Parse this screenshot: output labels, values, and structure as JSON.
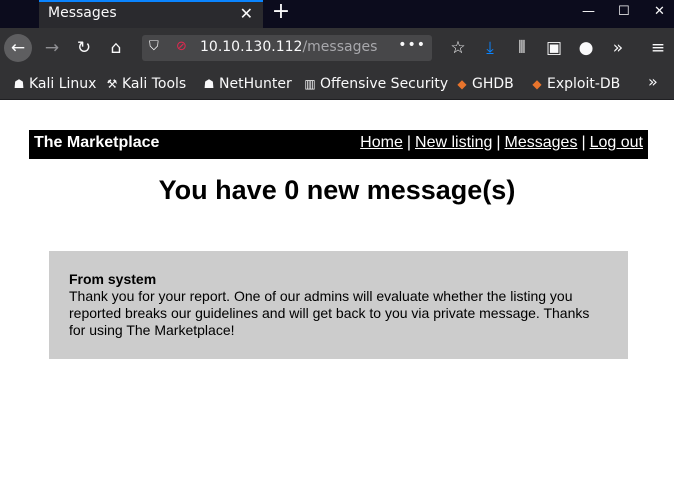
{
  "browser": {
    "tab_title": "Messages",
    "url_host": "10.10.130.112",
    "url_path": "/messages",
    "bookmarks": [
      "Kali Linux",
      "Kali Tools",
      "NetHunter",
      "Offensive Security",
      "GHDB",
      "Exploit-DB"
    ]
  },
  "site": {
    "brand": "The Marketplace",
    "nav": [
      "Home",
      "New listing",
      "Messages",
      "Log out"
    ],
    "separator": "|"
  },
  "main": {
    "heading": "You have 0 new message(s)",
    "messages": [
      {
        "from": "From system",
        "body": "Thank you for your report. One of our admins will evaluate whether the listing you reported breaks our guidelines and will get back to you via private message. Thanks for using The Marketplace!"
      }
    ]
  },
  "colors": {
    "accent": "#0a84ff",
    "header_bg": "#000000",
    "message_bg": "#cccccc",
    "chrome_bg": "#323234"
  },
  "icons": {
    "back": "arrow-left-icon",
    "forward": "arrow-right-icon",
    "reload": "reload-icon",
    "home": "home-icon"
  }
}
